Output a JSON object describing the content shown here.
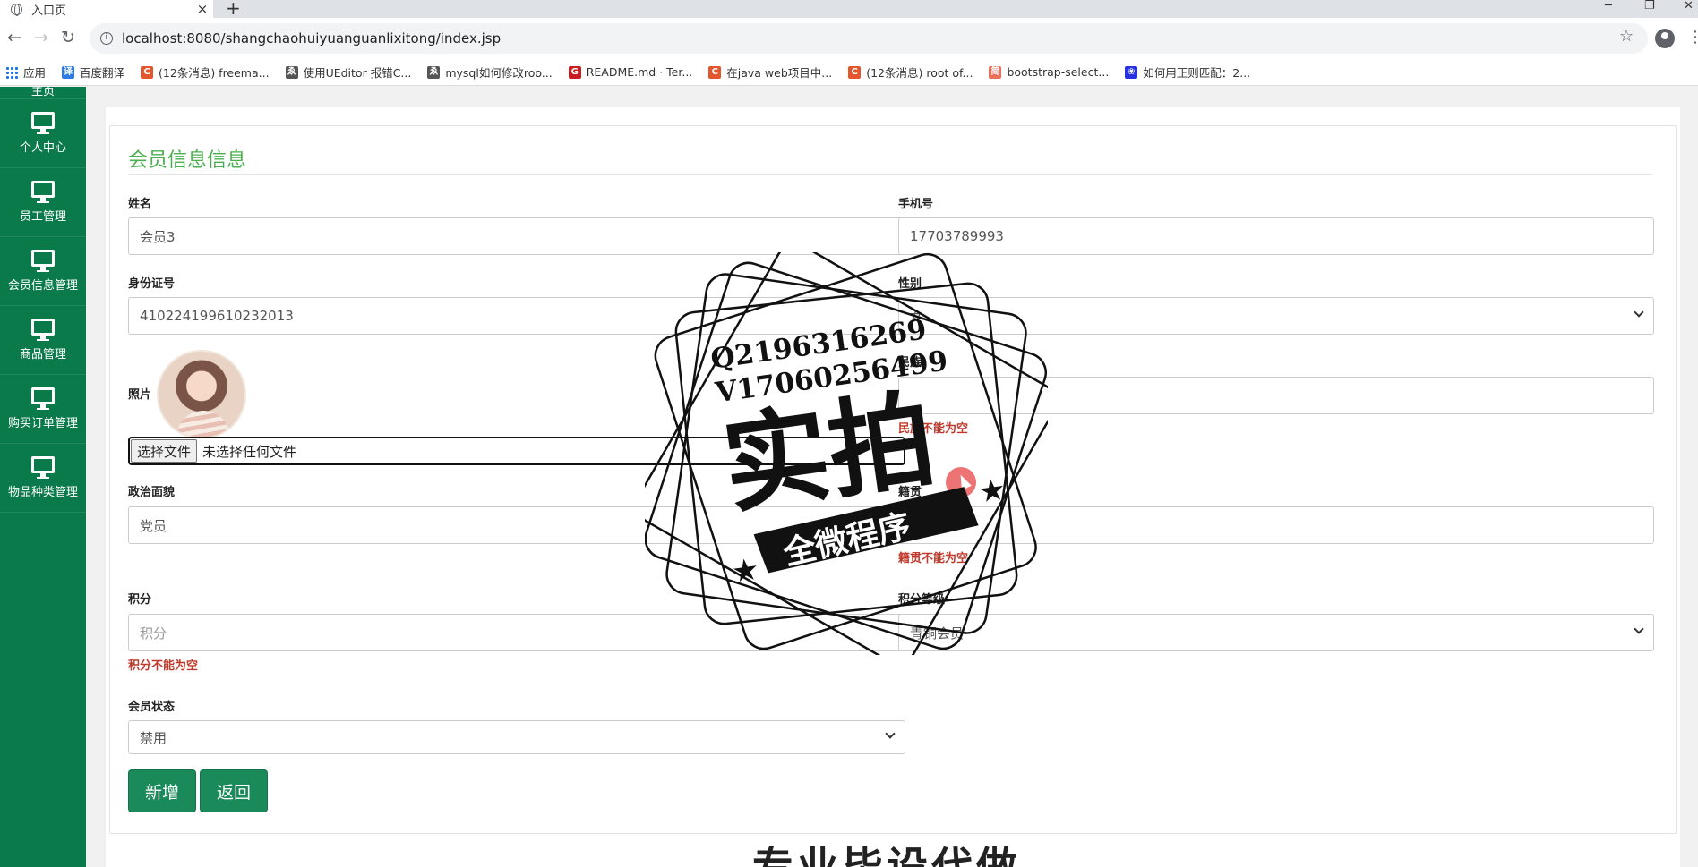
{
  "browser": {
    "tab_title": "入口页",
    "tab_close": "×",
    "new_tab": "+",
    "url": "localhost:8080/shangchaohuiyuanguanlixitong/index.jsp",
    "bookmarks": [
      {
        "label": "应用",
        "icon": "apps-grid-icon"
      },
      {
        "label": "百度翻译",
        "icon": "baidu-translate-icon",
        "color": "#2d7be5",
        "glyph": "译"
      },
      {
        "label": "(12条消息) freema...",
        "icon": "csdn-icon",
        "color": "#e4572e",
        "glyph": "C"
      },
      {
        "label": "使用UEditor 报错C...",
        "icon": "script-icon",
        "color": "#555555",
        "glyph": "ゑ"
      },
      {
        "label": "mysql如何修改roo...",
        "icon": "script-icon",
        "color": "#555555",
        "glyph": "ゑ"
      },
      {
        "label": "README.md · Ter...",
        "icon": "gitee-icon",
        "color": "#c71d23",
        "glyph": "G"
      },
      {
        "label": "在java web项目中...",
        "icon": "csdn-icon",
        "color": "#e4572e",
        "glyph": "C"
      },
      {
        "label": "(12条消息) root of...",
        "icon": "csdn-icon",
        "color": "#e4572e",
        "glyph": "C"
      },
      {
        "label": "bootstrap-select...",
        "icon": "jianshu-icon",
        "color": "#ea6f5a",
        "glyph": "简"
      },
      {
        "label": "如何用正则匹配：2...",
        "icon": "baidu-paw-icon",
        "color": "#2932e1",
        "glyph": "❀"
      }
    ]
  },
  "sidebar": {
    "partial_label": "主页",
    "items": [
      {
        "label": "个人中心"
      },
      {
        "label": "员工管理"
      },
      {
        "label": "会员信息管理"
      },
      {
        "label": "商品管理"
      },
      {
        "label": "购买订单管理"
      },
      {
        "label": "物品种类管理"
      }
    ]
  },
  "form": {
    "title": "会员信息信息",
    "name": {
      "label": "姓名",
      "value": "会员3"
    },
    "phone": {
      "label": "手机号",
      "value": "17703789993"
    },
    "idcard": {
      "label": "身份证号",
      "value": "410224199610232013"
    },
    "gender": {
      "label": "性别",
      "value": "女"
    },
    "photo": {
      "label": "照片"
    },
    "file": {
      "button": "选择文件",
      "status": "未选择任何文件"
    },
    "ethnicity": {
      "label": "民族",
      "error": "民族不能为空"
    },
    "political": {
      "label": "政治面貌",
      "value": "党员"
    },
    "native_place": {
      "label": "籍贯",
      "error": "籍贯不能为空"
    },
    "points": {
      "label": "积分",
      "placeholder": "积分",
      "error": "积分不能为空"
    },
    "points_level": {
      "label": "积分等级",
      "value": "青铜会员"
    },
    "status": {
      "label": "会员状态",
      "value": "禁用"
    },
    "buttons": {
      "add": "新增",
      "back": "返回"
    }
  },
  "footer_text": "专业毕设代做",
  "watermark": {
    "line1": "Q2196316269",
    "line2": "V17060256499",
    "big": "实拍",
    "ribbon": "全微程序"
  }
}
